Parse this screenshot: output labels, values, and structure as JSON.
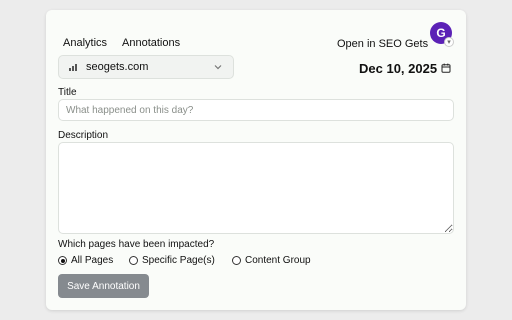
{
  "nav": {
    "analytics": "Analytics",
    "annotations": "Annotations"
  },
  "header": {
    "open_link": "Open in SEO Gets",
    "avatar_initial": "G"
  },
  "site_select": {
    "value": "seogets.com",
    "icon": "site-favicon"
  },
  "date": {
    "value": "Dec 10, 2025",
    "icon": "calendar-icon"
  },
  "title_field": {
    "label": "Title",
    "placeholder": "What happened on this day?",
    "value": ""
  },
  "description_field": {
    "label": "Description",
    "value": ""
  },
  "impact": {
    "question": "Which pages have been impacted?",
    "options": [
      {
        "label": "All Pages",
        "checked": true
      },
      {
        "label": "Specific Page(s)",
        "checked": false
      },
      {
        "label": "Content Group",
        "checked": false
      }
    ]
  },
  "save_button": {
    "label": "Save Annotation",
    "color": "#858a8f"
  },
  "colors": {
    "avatar": "#5b21b6",
    "card_bg": "#fafcf9",
    "page_bg": "#ececec"
  }
}
